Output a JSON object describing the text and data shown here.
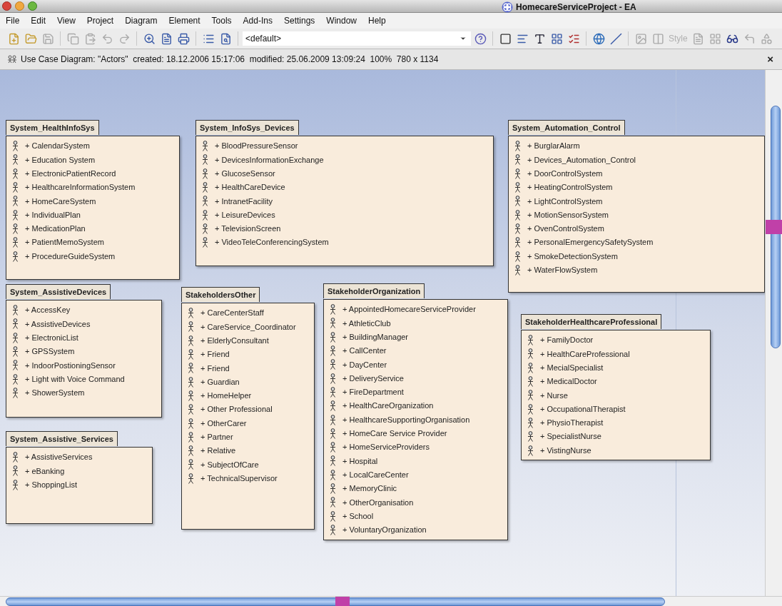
{
  "window": {
    "title": "HomecareServiceProject - EA"
  },
  "menu": [
    "File",
    "Edit",
    "View",
    "Project",
    "Diagram",
    "Element",
    "Tools",
    "Add-Ins",
    "Settings",
    "Window",
    "Help"
  ],
  "toolbar": {
    "combo": "<default>",
    "style_button": {
      "label": "Style",
      "disabled": true
    }
  },
  "diagram_header": {
    "text": "Use Case Diagram: \"Actors\"  created: 18.12.2006 15:17:06  modified: 25.06.2009 13:09:24  100%  780 x 1134",
    "close": "×"
  },
  "packages": [
    {
      "name": "System_HealthInfoSys",
      "actors": [
        "+ CalendarSystem",
        "+ Education System",
        "+ ElectronicPatientRecord",
        "+ HealthcareInformationSystem",
        "+ HomeCareSystem",
        "+ IndividualPlan",
        "+ MedicationPlan",
        "+ PatientMemoSystem",
        "+ ProcedureGuideSystem"
      ]
    },
    {
      "name": "System_InfoSys_Devices",
      "actors": [
        "+ BloodPressureSensor",
        "+ DevicesInformationExchange",
        "+ GlucoseSensor",
        "+ HealthCareDevice",
        "+ IntranetFacility",
        "+ LeisureDevices",
        "+ TelevisionScreen",
        "+ VideoTeleConferencingSystem"
      ]
    },
    {
      "name": "System_Automation_Control",
      "actors": [
        "+ BurglarAlarm",
        "+ Devices_Automation_Control",
        "+ DoorControlSystem",
        "+ HeatingControlSystem",
        "+ LightControlSystem",
        "+ MotionSensorSystem",
        "+ OvenControlSystem",
        "+ PersonalEmergencySafetySystem",
        "+ SmokeDetectionSystem",
        "+ WaterFlowSystem"
      ]
    },
    {
      "name": "System_AssistiveDevices",
      "actors": [
        "+ AccessKey",
        "+ AssistiveDevices",
        "+ ElectronicList",
        "+ GPSSystem",
        "+ IndoorPostioningSensor",
        "+ Light with Voice Command",
        "+ ShowerSystem"
      ]
    },
    {
      "name": "StakeholdersOther",
      "actors": [
        "+ CareCenterStaff",
        "+ CareService_Coordinator",
        "+ ElderlyConsultant",
        "+ Friend",
        "+ Friend",
        "+ Guardian",
        "+ HomeHelper",
        "+ Other Professional",
        "+ OtherCarer",
        "+ Partner",
        "+ Relative",
        "+ SubjectOfCare",
        "+ TechnicalSupervisor"
      ]
    },
    {
      "name": "StakeholderOrganization",
      "actors": [
        "+ AppointedHomecareServiceProvider",
        "+ AthleticClub",
        "+ BuildingManager",
        "+ CallCenter",
        "+ DayCenter",
        "+ DeliveryService",
        "+ FireDepartment",
        "+ HealthCareOrganization",
        "+ HealthcareSupportingOrganisation",
        "+ HomeCare Service Provider",
        "+ HomeServiceProviders",
        "+ Hospital",
        "+ LocalCareCenter",
        "+ MemoryClinic",
        "+ OtherOrganisation",
        "+ School",
        "+ VoluntaryOrganization"
      ]
    },
    {
      "name": "StakeholderHealthcareProfessional",
      "actors": [
        "+ FamilyDoctor",
        "+ HealthCareProfessional",
        "+ MecialSpecialist",
        "+ MedicalDoctor",
        "+ Nurse",
        "+ OccupationalTherapist",
        "+ PhysioTherapist",
        "+ SpecialistNurse",
        "+ VistingNurse"
      ]
    },
    {
      "name": "System_Assistive_Services",
      "actors": [
        "+ AssistiveServices",
        "+ eBanking",
        "+ ShoppingList"
      ]
    }
  ]
}
